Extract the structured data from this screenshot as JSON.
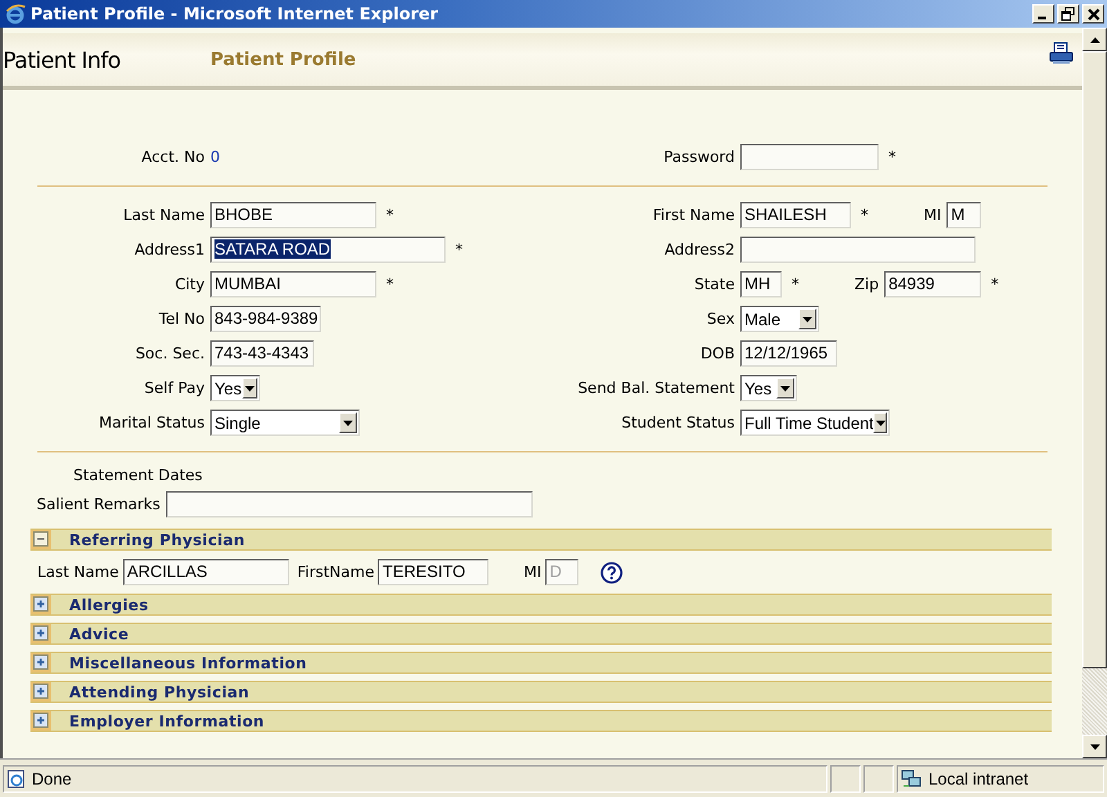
{
  "window": {
    "title": "Patient Profile - Microsoft Internet Explorer"
  },
  "header": {
    "app_title": "Patient Info",
    "page_title": "Patient Profile"
  },
  "form_groups": [
    {
      "rows": [
        {
          "left": {
            "label": "Acct. No",
            "kind": "value",
            "value": "0"
          },
          "right": {
            "label": "Password",
            "kind": "password",
            "required_mark": "*"
          }
        }
      ]
    },
    {
      "rows": [
        {
          "left": {
            "label": "Last Name",
            "kind": "text",
            "value": "BHOBE",
            "required_mark": "*"
          },
          "right": {
            "label": "First Name",
            "kind": "text",
            "value": "SHAILESH",
            "required_mark": "*",
            "extra": {
              "label": "MI",
              "kind": "text",
              "value": "M"
            }
          }
        },
        {
          "left": {
            "label": "Address1",
            "kind": "text",
            "value": "SATARA ROAD",
            "required_mark": "*",
            "highlighted": true
          },
          "right": {
            "label": "Address2",
            "kind": "text"
          }
        },
        {
          "left": {
            "label": "City",
            "kind": "text",
            "value": "MUMBAI",
            "required_mark": "*"
          },
          "right": {
            "label": "State",
            "kind": "text",
            "value": "MH",
            "required_mark": "*",
            "extra": {
              "label": "Zip",
              "kind": "text",
              "value": "84939",
              "required_mark": "*"
            }
          }
        },
        {
          "left": {
            "label": "Tel No",
            "kind": "text",
            "value": "843-984-9389"
          },
          "right": {
            "label": "Sex",
            "kind": "select",
            "value": "Male"
          }
        },
        {
          "left": {
            "label": "Soc. Sec.",
            "kind": "text",
            "value": "743-43-4343"
          },
          "right": {
            "label": "DOB",
            "kind": "text",
            "value": "12/12/1965"
          }
        },
        {
          "left": {
            "label": "Self Pay",
            "kind": "select",
            "value": "Yes"
          },
          "right": {
            "label": "Send Bal. Statement",
            "kind": "select",
            "value": "Yes"
          }
        },
        {
          "left": {
            "label": "Marital Status",
            "kind": "select",
            "value": "Single"
          },
          "right": {
            "label": "Student Status",
            "kind": "select",
            "value": "Full Time Student"
          }
        }
      ]
    }
  ],
  "statement_dates": {
    "label": "Statement Dates"
  },
  "salient_remarks": {
    "label": "Salient Remarks"
  },
  "panels": [
    {
      "title": "Referring Physician",
      "expanded": true,
      "fields": [
        {
          "label": "Last Name",
          "value": "ARCILLAS",
          "disabled": false
        },
        {
          "label": "FirstName",
          "value": "TERESITO",
          "disabled": false
        },
        {
          "label": "MI",
          "value": "D",
          "disabled": true
        }
      ]
    },
    {
      "title": "Allergies",
      "expanded": false
    },
    {
      "title": "Advice",
      "expanded": false
    },
    {
      "title": "Miscellaneous Information",
      "expanded": false
    },
    {
      "title": "Attending Physician",
      "expanded": false
    },
    {
      "title": "Employer Information",
      "expanded": false
    }
  ],
  "status_bar": {
    "text": "Done",
    "zone": "Local intranet"
  }
}
